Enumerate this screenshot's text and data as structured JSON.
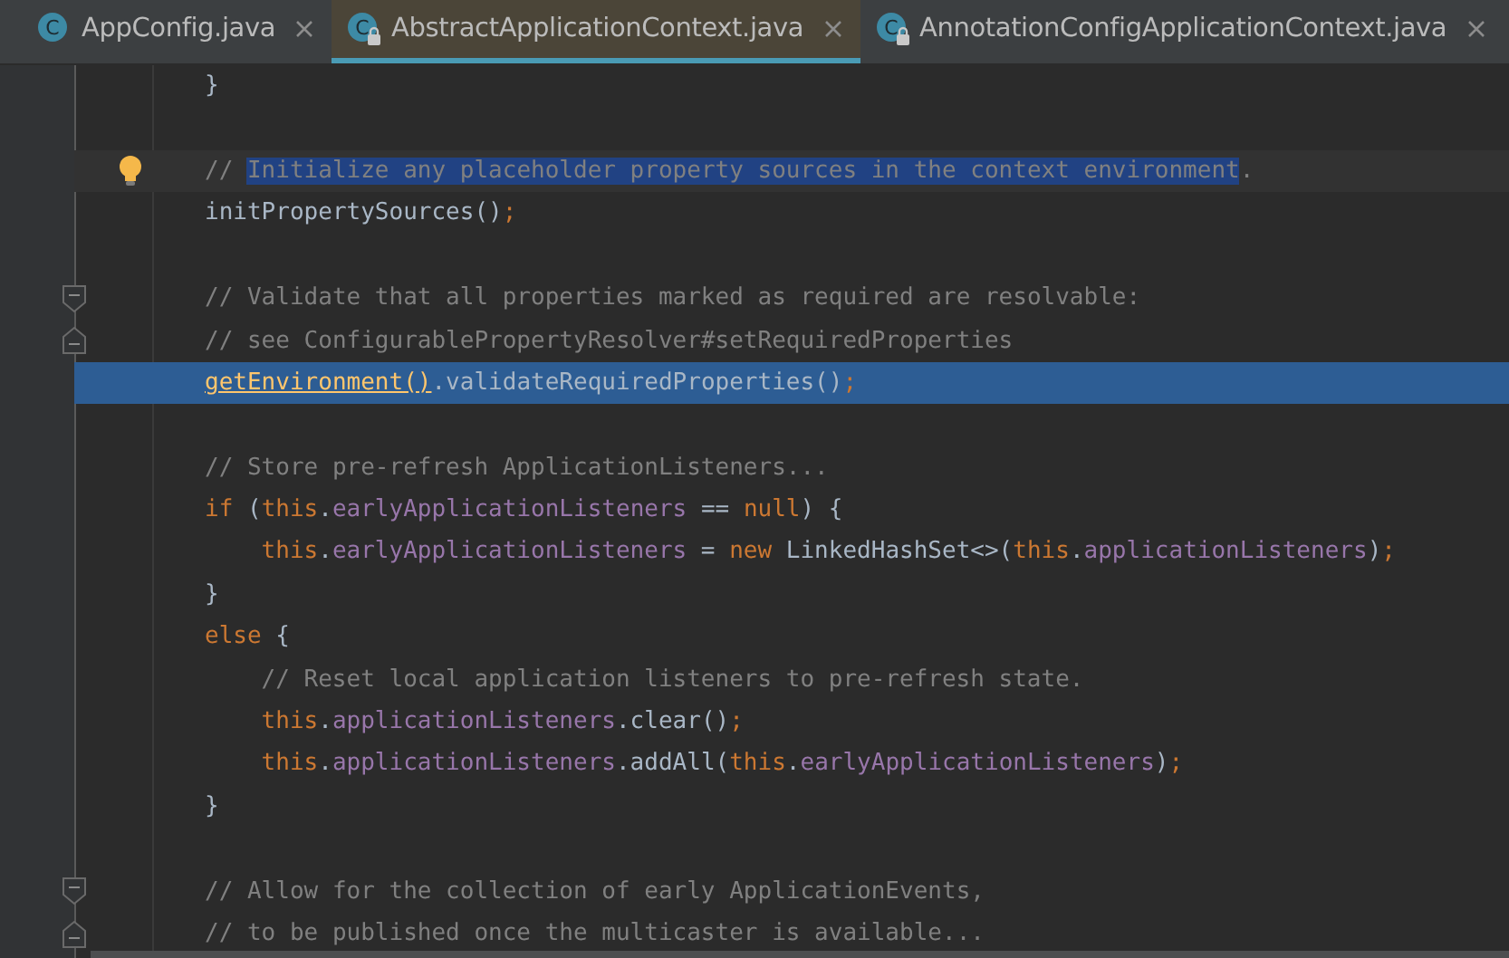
{
  "tabs": [
    {
      "label": "AppConfig.java",
      "icon_letter": "C",
      "locked": false,
      "selected": false
    },
    {
      "label": "AbstractApplicationContext.java",
      "icon_letter": "C",
      "locked": true,
      "selected": true
    },
    {
      "label": "AnnotationConfigApplicationContext.java",
      "icon_letter": "C",
      "locked": true,
      "selected": false
    }
  ],
  "lines": [
    {
      "kind": "line",
      "tokens": [
        {
          "kind": "plain",
          "text": "}"
        }
      ]
    },
    {
      "kind": "line"
    },
    {
      "kind": "caret-line",
      "gutter": {
        "kind": "bulb"
      },
      "tokens": [
        {
          "kind": "comment",
          "text": "// "
        },
        {
          "kind": "selected-comment",
          "text": "Initialize any placeholder property sources in the context environment"
        },
        {
          "kind": "comment",
          "text": "."
        }
      ]
    },
    {
      "kind": "line",
      "tokens": [
        {
          "kind": "plain",
          "text": "initPropertySources()"
        },
        {
          "kind": "keyword",
          "text": ";"
        }
      ]
    },
    {
      "kind": "line"
    },
    {
      "kind": "line",
      "gutter": {
        "kind": "fold-start"
      },
      "tokens": [
        {
          "kind": "comment",
          "text": "// Validate that all properties marked as required are resolvable:"
        }
      ]
    },
    {
      "kind": "line",
      "gutter": {
        "kind": "fold-end"
      },
      "tokens": [
        {
          "kind": "comment",
          "text": "// see ConfigurablePropertyResolver#setRequiredProperties"
        }
      ]
    },
    {
      "kind": "selected-line",
      "tokens": [
        {
          "kind": "link",
          "text": "getEnvironment()"
        },
        {
          "kind": "plain",
          "text": ".validateRequiredProperties()"
        },
        {
          "kind": "keyword",
          "text": ";"
        }
      ]
    },
    {
      "kind": "line"
    },
    {
      "kind": "line",
      "tokens": [
        {
          "kind": "comment",
          "text": "// Store pre-refresh ApplicationListeners..."
        }
      ]
    },
    {
      "kind": "line",
      "tokens": [
        {
          "kind": "keyword",
          "text": "if "
        },
        {
          "kind": "plain",
          "text": "("
        },
        {
          "kind": "keyword",
          "text": "this"
        },
        {
          "kind": "plain",
          "text": "."
        },
        {
          "kind": "field",
          "text": "earlyApplicationListeners"
        },
        {
          "kind": "plain",
          "text": " == "
        },
        {
          "kind": "keyword",
          "text": "null"
        },
        {
          "kind": "plain",
          "text": ") {"
        }
      ]
    },
    {
      "kind": "line",
      "indented": true,
      "tokens": [
        {
          "kind": "keyword",
          "text": "this"
        },
        {
          "kind": "plain",
          "text": "."
        },
        {
          "kind": "field",
          "text": "earlyApplicationListeners"
        },
        {
          "kind": "plain",
          "text": " = "
        },
        {
          "kind": "keyword",
          "text": "new "
        },
        {
          "kind": "plain",
          "text": "LinkedHashSet<>("
        },
        {
          "kind": "keyword",
          "text": "this"
        },
        {
          "kind": "plain",
          "text": "."
        },
        {
          "kind": "field",
          "text": "applicationListeners"
        },
        {
          "kind": "plain",
          "text": ")"
        },
        {
          "kind": "keyword",
          "text": ";"
        }
      ]
    },
    {
      "kind": "line",
      "tokens": [
        {
          "kind": "plain",
          "text": "}"
        }
      ]
    },
    {
      "kind": "line",
      "tokens": [
        {
          "kind": "keyword",
          "text": "else "
        },
        {
          "kind": "plain",
          "text": "{"
        }
      ]
    },
    {
      "kind": "line",
      "indented": true,
      "tokens": [
        {
          "kind": "comment",
          "text": "// Reset local application listeners to pre-refresh state."
        }
      ]
    },
    {
      "kind": "line",
      "indented": true,
      "tokens": [
        {
          "kind": "keyword",
          "text": "this"
        },
        {
          "kind": "plain",
          "text": "."
        },
        {
          "kind": "field",
          "text": "applicationListeners"
        },
        {
          "kind": "plain",
          "text": ".clear()"
        },
        {
          "kind": "keyword",
          "text": ";"
        }
      ]
    },
    {
      "kind": "line",
      "indented": true,
      "tokens": [
        {
          "kind": "keyword",
          "text": "this"
        },
        {
          "kind": "plain",
          "text": "."
        },
        {
          "kind": "field",
          "text": "applicationListeners"
        },
        {
          "kind": "plain",
          "text": ".addAll("
        },
        {
          "kind": "keyword",
          "text": "this"
        },
        {
          "kind": "plain",
          "text": "."
        },
        {
          "kind": "field",
          "text": "earlyApplicationListeners"
        },
        {
          "kind": "plain",
          "text": ")"
        },
        {
          "kind": "keyword",
          "text": ";"
        }
      ]
    },
    {
      "kind": "line",
      "tokens": [
        {
          "kind": "plain",
          "text": "}"
        }
      ]
    },
    {
      "kind": "line"
    },
    {
      "kind": "line",
      "gutter": {
        "kind": "fold-start"
      },
      "tokens": [
        {
          "kind": "comment",
          "text": "// Allow for the collection of early ApplicationEvents,"
        }
      ]
    },
    {
      "kind": "line",
      "gutter": {
        "kind": "fold-end"
      },
      "tokens": [
        {
          "kind": "comment",
          "text": "// to be published once the multicaster is available..."
        }
      ]
    }
  ]
}
